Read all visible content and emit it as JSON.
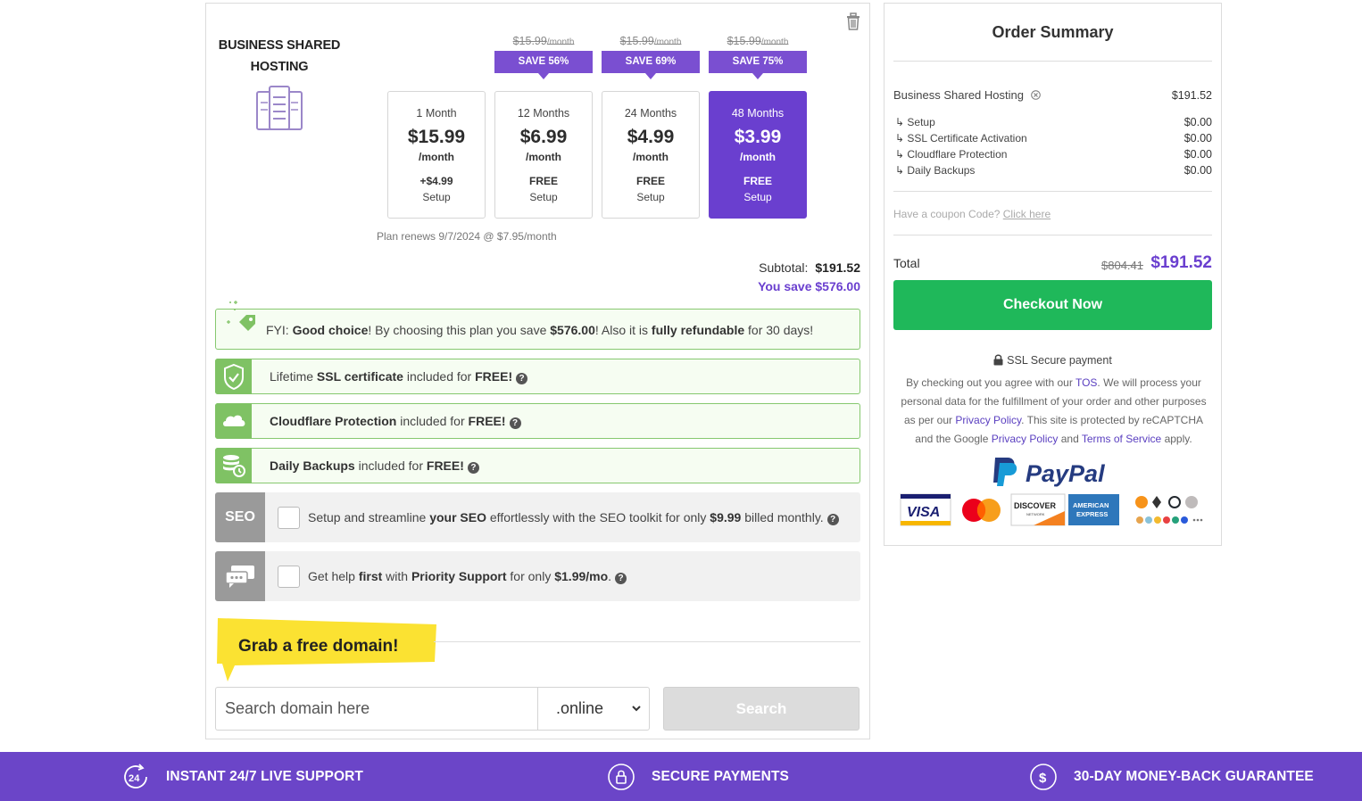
{
  "product": {
    "title_line1": "BUSINESS SHARED",
    "title_line2": "HOSTING"
  },
  "plans": [
    {
      "old_price": "",
      "old_price_unit": "",
      "save": "",
      "term": "1 Month",
      "price": "$15.99",
      "per": "/month",
      "setup_fee": "+$4.99",
      "setup_label": "Setup",
      "selected": false
    },
    {
      "old_price": "$15.99",
      "old_price_unit": "/month",
      "save": "SAVE 56%",
      "term": "12 Months",
      "price": "$6.99",
      "per": "/month",
      "setup_fee": "FREE",
      "setup_label": "Setup",
      "selected": false
    },
    {
      "old_price": "$15.99",
      "old_price_unit": "/month",
      "save": "SAVE 69%",
      "term": "24 Months",
      "price": "$4.99",
      "per": "/month",
      "setup_fee": "FREE",
      "setup_label": "Setup",
      "selected": false
    },
    {
      "old_price": "$15.99",
      "old_price_unit": "/month",
      "save": "SAVE 75%",
      "term": "48 Months",
      "price": "$3.99",
      "per": "/month",
      "setup_fee": "FREE",
      "setup_label": "Setup",
      "selected": true
    }
  ],
  "renew_note": "Plan renews 9/7/2024 @ $7.95/month",
  "subtotal": {
    "label": "Subtotal:",
    "value": "$191.52"
  },
  "you_save": {
    "label": "You save",
    "value": "$576.00"
  },
  "fyi": {
    "prefix": "FYI: ",
    "bold1": "Good choice",
    "mid1": "! By choosing this plan you save ",
    "bold2": "$576.00",
    "mid2": "! Also it is ",
    "bold3": "fully refundable",
    "suffix": " for 30 days!"
  },
  "features": [
    {
      "pre": "Lifetime ",
      "bold": "SSL certificate",
      "mid": " included for ",
      "bold2": "FREE!",
      "icon": "shield-lock-icon"
    },
    {
      "pre": "",
      "bold": "Cloudflare Protection",
      "mid": " included for ",
      "bold2": "FREE!",
      "icon": "cloud-icon"
    },
    {
      "pre": "",
      "bold": "Daily Backups",
      "mid": " included for ",
      "bold2": "FREE!",
      "icon": "database-backup-icon"
    }
  ],
  "addons": [
    {
      "icon_label": "SEO",
      "pre": "Setup and streamline ",
      "bold": "your SEO",
      "mid": " effortlessly with the SEO toolkit for only ",
      "bold2": "$9.99",
      "suffix": " billed monthly.",
      "checked": false
    },
    {
      "icon_label": "",
      "pre": "Get help ",
      "bold": "first",
      "mid": " with ",
      "bold2": "Priority Support",
      "mid2": " for only ",
      "bold3": "$1.99/mo",
      "suffix": ".",
      "checked": false
    }
  ],
  "domain": {
    "banner": "Grab a free domain!",
    "placeholder": "Search domain here",
    "tld": ".online",
    "search_label": "Search"
  },
  "order_summary": {
    "title": "Order Summary",
    "item": {
      "label": "Business Shared Hosting",
      "price": "$191.52"
    },
    "subitems": [
      {
        "label": "↳ Setup",
        "price": "$0.00"
      },
      {
        "label": "↳ SSL Certificate Activation",
        "price": "$0.00"
      },
      {
        "label": "↳ Cloudflare Protection",
        "price": "$0.00"
      },
      {
        "label": "↳ Daily Backups",
        "price": "$0.00"
      }
    ],
    "coupon_text": "Have a coupon Code? ",
    "coupon_link": "Click here",
    "total_label": "Total",
    "total_old": "$804.41",
    "total_new": "$191.52",
    "checkout_label": "Checkout Now",
    "ssl_text": "SSL Secure payment",
    "legal": {
      "t1": "By checking out you agree with our ",
      "tos": "TOS",
      "t2": ". We will process your personal data for the fulfillment of your order and other purposes as per our ",
      "privacy": "Privacy Policy",
      "t3": ". This site is protected by reCAPTCHA and the Google ",
      "privacy2": "Privacy Policy",
      "t4": " and ",
      "terms": "Terms of Service",
      "t5": " apply."
    },
    "paypal_text": "PayPal",
    "card_labels": {
      "visa": "VISA",
      "discover": "DISCOVER",
      "discover_sub": "NETWORK",
      "amex1": "AMERICAN",
      "amex2": "EXPRESS"
    }
  },
  "footer": {
    "support": "INSTANT 24/7 LIVE SUPPORT",
    "support_icon_text": "24",
    "secure": "SECURE PAYMENTS",
    "guarantee": "30-DAY MONEY-BACK GUARANTEE",
    "guarantee_icon_text": "$"
  },
  "colors": {
    "purple": "#6a3fcf",
    "green": "#1fb85a",
    "feature_green": "#7fc264",
    "footer": "#6b45c8"
  }
}
